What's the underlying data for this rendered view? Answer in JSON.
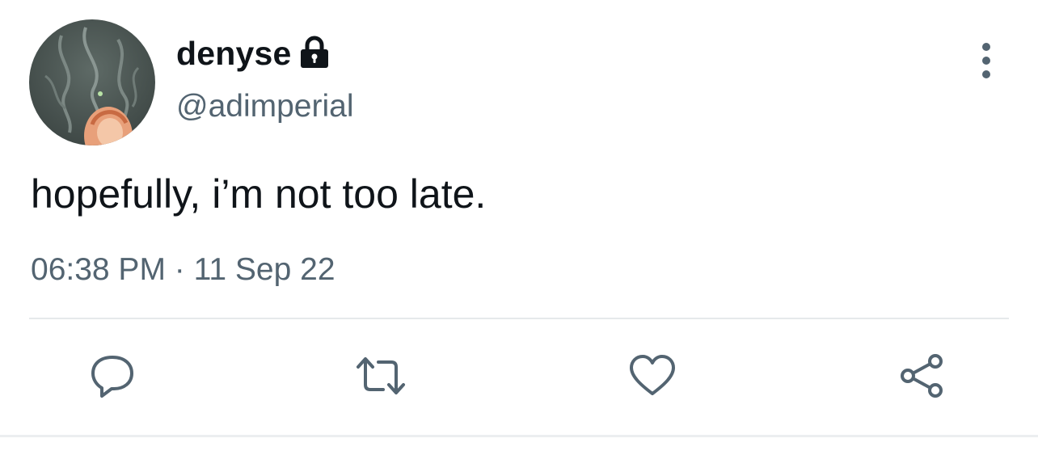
{
  "tweet": {
    "author": {
      "display_name": "denyse",
      "handle": "@adimperial",
      "protected_icon": "lock-icon",
      "avatar_icon": "avatar-image"
    },
    "text": "hopefully, i’m not too late.",
    "timestamp": "06:38 PM · 11 Sep 22",
    "menu_icon": "more-vertical-icon"
  },
  "actions": [
    {
      "name": "reply",
      "icon": "reply-icon"
    },
    {
      "name": "retweet",
      "icon": "retweet-icon"
    },
    {
      "name": "like",
      "icon": "heart-icon"
    },
    {
      "name": "share",
      "icon": "share-icon"
    }
  ],
  "colors": {
    "text_primary": "#0f1419",
    "text_secondary": "#536471",
    "divider": "#e6e9eb",
    "background": "#ffffff"
  }
}
